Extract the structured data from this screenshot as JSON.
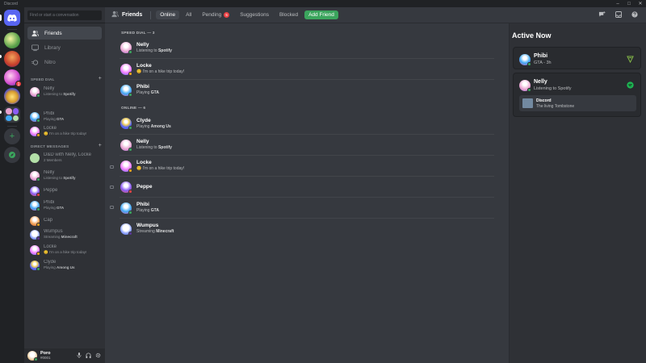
{
  "window": {
    "title": "Discord",
    "controls": [
      "–",
      "□",
      "✕"
    ]
  },
  "colors": {
    "online": "#3ba55d",
    "idle": "#faa81a",
    "dnd": "#ed4245",
    "streaming": "#593695",
    "offline": "#747f8d",
    "brand": "#5865f2"
  },
  "rail": {
    "mention_count": "1"
  },
  "sidebar": {
    "search_placeholder": "Find or start a conversation",
    "nav": [
      {
        "label": "Friends",
        "icon": "friends-icon"
      },
      {
        "label": "Library",
        "icon": "library-icon"
      },
      {
        "label": "Nitro",
        "icon": "nitro-icon"
      }
    ],
    "speed_dial_header": "SPEED DIAL",
    "speed_dial": [
      {
        "name": "Nelly",
        "activity_prefix": "Listening to ",
        "activity": "Spotify",
        "status": "online",
        "color": "#e8a3d0"
      },
      {
        "name": "Phibi",
        "activity_prefix": "Playing ",
        "activity": "GTA",
        "status": "online",
        "color": "#3fa9f5"
      },
      {
        "name": "Locke",
        "activity_prefix": "😊 ",
        "activity": "",
        "text": "I'm on a hike trip today!",
        "status": "idle",
        "color": "#f47fff"
      }
    ],
    "dm_header": "DIRECT MESSAGES",
    "dms": [
      {
        "name": "D&D with Nelly, Locke",
        "sub": "2 Members",
        "color": "#b3e0a8",
        "status": ""
      },
      {
        "name": "Nelly",
        "sub_prefix": "Listening to ",
        "sub_bold": "Spotify",
        "color": "#e8a3d0",
        "status": "online"
      },
      {
        "name": "Peppe",
        "sub": "",
        "color": "#8a5cf5",
        "status": "dnd"
      },
      {
        "name": "Phibi",
        "sub_prefix": "Playing ",
        "sub_bold": "GTA",
        "color": "#3fa9f5",
        "status": "online"
      },
      {
        "name": "Cap",
        "sub": "",
        "color": "#f5a65b",
        "status": "idle"
      },
      {
        "name": "Wumpus",
        "sub_prefix": "Streaming ",
        "sub_bold": "Minecraft",
        "color": "#ffffff",
        "status": "streaming"
      },
      {
        "name": "Locke",
        "sub": "😊 I'm on a hike trip today!",
        "color": "#f47fff",
        "status": "idle"
      },
      {
        "name": "Clyde",
        "sub_prefix": "Playing ",
        "sub_bold": "Among Us",
        "color": "#5865f2",
        "status": "online"
      }
    ],
    "user": {
      "name": "Poro",
      "tag": "#0001"
    }
  },
  "topbar": {
    "title": "Friends",
    "tabs": {
      "online": "Online",
      "all": "All",
      "pending": "Pending",
      "pending_count": "5",
      "suggestions": "Suggestions",
      "blocked": "Blocked",
      "add_friend": "Add Friend"
    }
  },
  "main": {
    "speed_dial_header": "SPEED DIAL — 3",
    "speed_dial": [
      {
        "name": "Nelly",
        "prefix": "Listening to ",
        "bold": "Spotify",
        "color": "#e8a3d0",
        "status": "online"
      },
      {
        "name": "Locke",
        "prefix": "😊 I'm on a hike trip today!",
        "bold": "",
        "color": "#f47fff",
        "status": "idle"
      },
      {
        "name": "Phibi",
        "prefix": "Playing ",
        "bold": "GTA",
        "color": "#3fa9f5",
        "status": "online"
      }
    ],
    "online_header": "ONLINE — 6",
    "online": [
      {
        "name": "Clyde",
        "prefix": "Playing ",
        "bold": "Among Us",
        "color": "#5865f2",
        "status": "online"
      },
      {
        "name": "Nelly",
        "prefix": "Listening to ",
        "bold": "Spotify",
        "color": "#e8a3d0",
        "status": "online"
      },
      {
        "name": "Locke",
        "prefix": "😊 I'm on a hike trip today!",
        "bold": "",
        "color": "#f47fff",
        "status": "idle"
      },
      {
        "name": "Peppe",
        "prefix": "",
        "bold": "",
        "color": "#8a5cf5",
        "status": "dnd"
      },
      {
        "name": "Phibi",
        "prefix": "Playing ",
        "bold": "GTA",
        "color": "#3fa9f5",
        "status": "online"
      },
      {
        "name": "Wumpus",
        "prefix": "Streaming ",
        "bold": "Minecraft",
        "color": "#ffffff",
        "status": "streaming"
      }
    ]
  },
  "active_now": {
    "title": "Active Now",
    "cards": [
      {
        "name": "Phibi",
        "sub": "GTA - 3h",
        "color": "#3fa9f5"
      },
      {
        "name": "Nelly",
        "sub": "Listening to Spotify",
        "color": "#e8a3d0",
        "track_title": "Discord",
        "track_sub": "The living Tombstone"
      }
    ]
  }
}
